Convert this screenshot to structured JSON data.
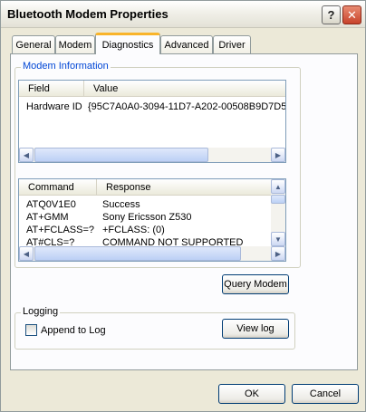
{
  "window": {
    "title": "Bluetooth Modem Properties",
    "help_glyph": "?",
    "close_glyph": "✕"
  },
  "tabs": [
    {
      "label": "General",
      "active": false
    },
    {
      "label": "Modem",
      "active": false
    },
    {
      "label": "Diagnostics",
      "active": true
    },
    {
      "label": "Advanced",
      "active": false
    },
    {
      "label": "Driver",
      "active": false
    }
  ],
  "modem_info": {
    "legend": "Modem Information",
    "columns": [
      "Field",
      "Value"
    ],
    "rows": [
      {
        "field": "Hardware ID",
        "value": "{95C7A0A0-3094-11D7-A202-00508B9D7D5"
      }
    ]
  },
  "diagnostics": {
    "columns": [
      "Command",
      "Response"
    ],
    "rows": [
      {
        "command": "ATQ0V1E0",
        "response": "Success"
      },
      {
        "command": "AT+GMM",
        "response": "Sony Ericsson Z530"
      },
      {
        "command": "AT+FCLASS=?",
        "response": "+FCLASS: (0)"
      },
      {
        "command": "AT#CLS=?",
        "response": "COMMAND NOT SUPPORTED"
      }
    ],
    "query_button": "Query Modem"
  },
  "logging": {
    "legend": "Logging",
    "append_label": "Append to Log",
    "append_checked": false,
    "view_log_button": "View log"
  },
  "footer": {
    "ok": "OK",
    "cancel": "Cancel"
  },
  "scroll_glyphs": {
    "left": "◀",
    "right": "▶",
    "up": "▲",
    "down": "▼"
  }
}
